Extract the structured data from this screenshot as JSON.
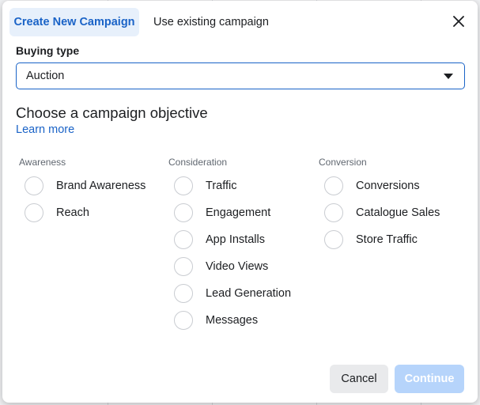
{
  "tabs": {
    "create_label": "Create New Campaign",
    "existing_label": "Use existing campaign"
  },
  "buying_type": {
    "label": "Buying type",
    "value": "Auction"
  },
  "objective": {
    "title": "Choose a campaign objective",
    "learn_more": "Learn more",
    "columns": [
      {
        "heading": "Awareness",
        "options": [
          "Brand Awareness",
          "Reach"
        ]
      },
      {
        "heading": "Consideration",
        "options": [
          "Traffic",
          "Engagement",
          "App Installs",
          "Video Views",
          "Lead Generation",
          "Messages"
        ]
      },
      {
        "heading": "Conversion",
        "options": [
          "Conversions",
          "Catalogue Sales",
          "Store Traffic"
        ]
      }
    ]
  },
  "footer": {
    "cancel_label": "Cancel",
    "continue_label": "Continue"
  },
  "colors": {
    "accent": "#1a63c7",
    "active_tab_bg": "#e7f0fb",
    "continue_disabled_bg": "#b6d4fb"
  },
  "icons": {
    "close": "close-icon",
    "dropdown": "chevron-down-icon"
  }
}
